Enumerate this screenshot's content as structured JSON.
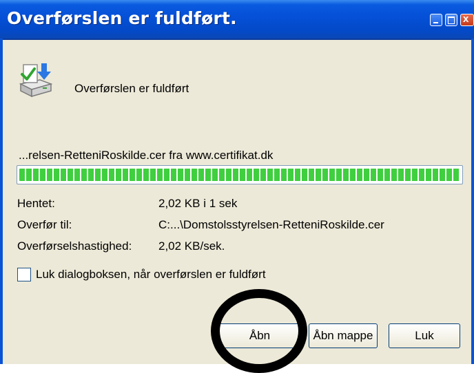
{
  "window": {
    "title": "Overførslen er fuldført."
  },
  "titlebar_buttons": {
    "minimize_icon": "minimize-icon",
    "maximize_icon": "maximize-icon",
    "close_icon": "close-icon"
  },
  "status": {
    "icon": "download-complete-icon",
    "text": "Overførslen er fuldført"
  },
  "transfer": {
    "source": "...relsen-RetteniRoskilde.cer fra www.certifikat.dk",
    "progress_percent": 100
  },
  "details": [
    {
      "label": "Hentet:",
      "value": "2,02 KB i 1 sek"
    },
    {
      "label": "Overfør til:",
      "value": "C:...\\Domstolsstyrelsen-RetteniRoskilde.cer"
    },
    {
      "label": "Overførselshastighed:",
      "value": "2,02 KB/sek."
    }
  ],
  "checkbox": {
    "label": "Luk dialogboksen, når overførslen er fuldført",
    "checked": false
  },
  "buttons": {
    "open": "Åbn",
    "open_folder": "Åbn mappe",
    "close": "Luk"
  },
  "colors": {
    "titlebar": "#0551d8",
    "dialog_bg": "#ECE9D8",
    "progress": "#3fcf3f",
    "annotation_ring": "#000000"
  }
}
